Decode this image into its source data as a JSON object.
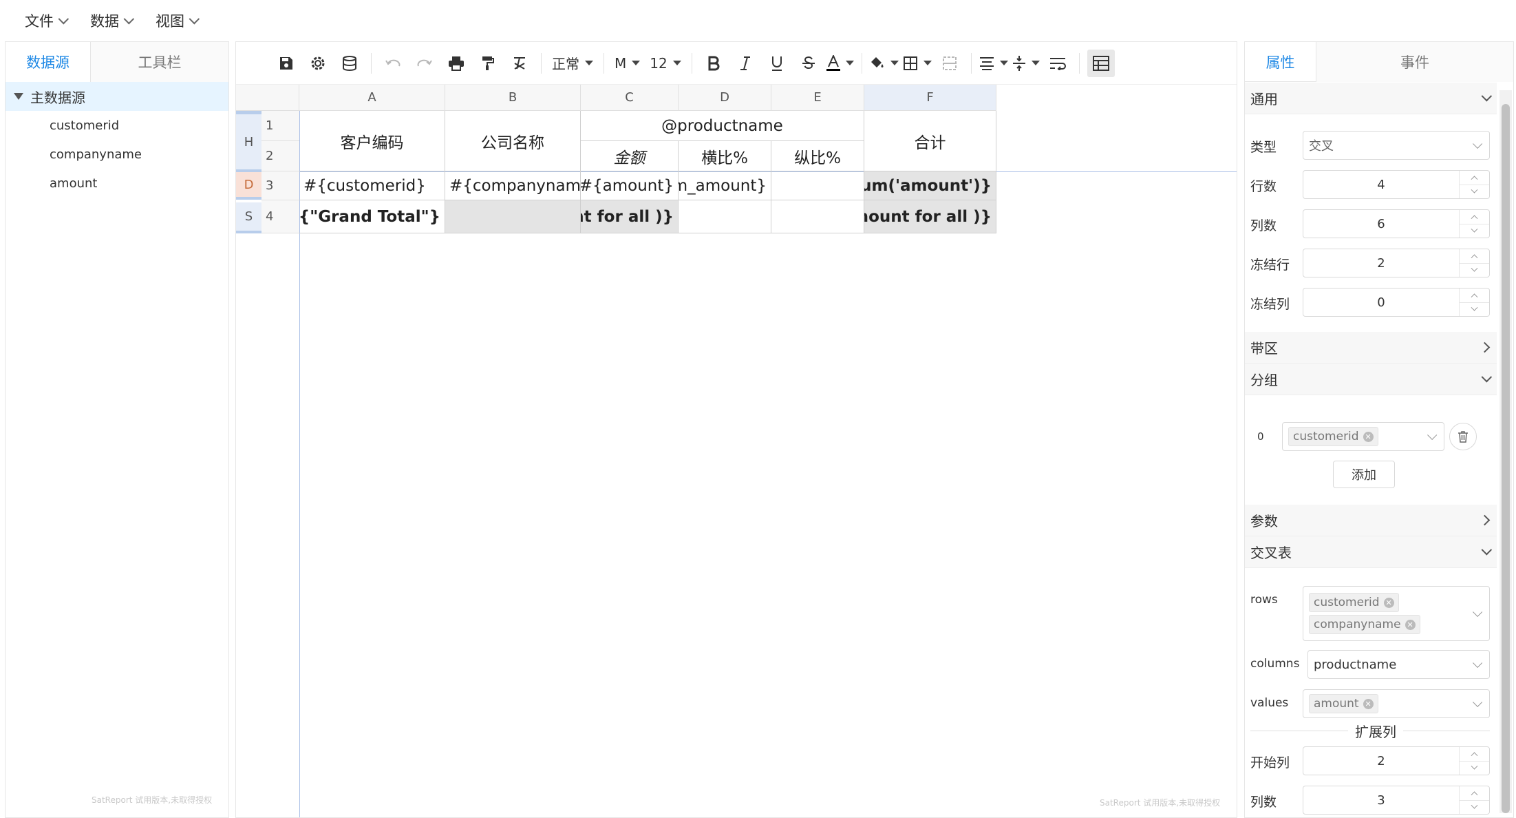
{
  "menu": [
    {
      "label": "文件"
    },
    {
      "label": "数据"
    },
    {
      "label": "视图"
    }
  ],
  "left": {
    "tabs": [
      "数据源",
      "工具栏"
    ],
    "root": "主数据源",
    "fields": [
      "customerid",
      "companyname",
      "amount"
    ],
    "watermark": "SatReport 试用版本,未取得授权"
  },
  "toolbar": {
    "style_label": "正常",
    "font_label": "M",
    "size_label": "12"
  },
  "sheet": {
    "columns": [
      "A",
      "B",
      "C",
      "D",
      "E",
      "F"
    ],
    "rows": [
      {
        "band": "H",
        "nums": [
          "1",
          "2"
        ]
      },
      {
        "band": "D",
        "nums": [
          "3"
        ]
      },
      {
        "band": "S",
        "nums": [
          "4"
        ]
      }
    ],
    "cells": {
      "a12": "客户编码",
      "b12": "公司名称",
      "cd1": "@productname",
      "c2": "金额",
      "d2": "横比%",
      "e2": "纵比%",
      "f12": "合计",
      "a3": "#{customerid}",
      "b3": "#{companyname}",
      "c3": "#{amount}",
      "d3": "ım_amount}",
      "e3": "",
      "f3": "ɔsum('amount')}",
      "a4": "#{\"Grand Total\"}",
      "b4": "",
      "c4": "unt for all )}",
      "d4": "",
      "e4": "",
      "f4": "amount for all )}"
    },
    "watermark": "SatReport 试用版本,未取得授权"
  },
  "right": {
    "tabs": [
      "属性",
      "事件"
    ],
    "general": {
      "title": "通用",
      "type_label": "类型",
      "type_value": "交叉",
      "rows_label": "行数",
      "rows_value": "4",
      "cols_label": "列数",
      "cols_value": "6",
      "freeze_rows_label": "冻结行",
      "freeze_rows_value": "2",
      "freeze_cols_label": "冻结列",
      "freeze_cols_value": "0"
    },
    "band_title": "带区",
    "group": {
      "title": "分组",
      "index": "0",
      "tag": "customerid",
      "add_label": "添加"
    },
    "params_title": "参数",
    "crosstab": {
      "title": "交叉表",
      "rows_label": "rows",
      "rows_tags": [
        "customerid",
        "companyname"
      ],
      "columns_label": "columns",
      "columns_value": "productname",
      "values_label": "values",
      "values_tag": "amount",
      "expand_label": "扩展列",
      "start_col_label": "开始列",
      "start_col_value": "2",
      "col_count_label": "列数",
      "col_count_value": "3"
    }
  }
}
